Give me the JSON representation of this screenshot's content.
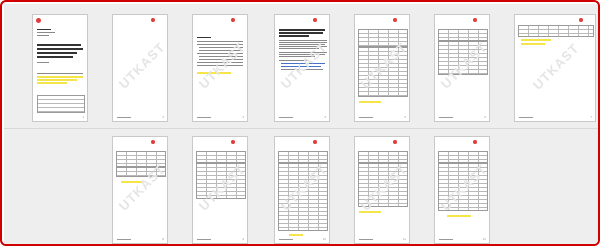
{
  "viewer": {
    "watermark": "UTKAST"
  },
  "pages": [
    {
      "number": "1"
    },
    {
      "number": "2"
    },
    {
      "number": "3"
    },
    {
      "number": "4"
    },
    {
      "number": "5"
    },
    {
      "number": "6"
    },
    {
      "number": "7"
    },
    {
      "number": "8"
    },
    {
      "number": "9"
    },
    {
      "number": "10"
    },
    {
      "number": "11"
    },
    {
      "number": "12"
    },
    {
      "number": "13"
    }
  ],
  "colors": {
    "frame_border": "#d00000",
    "highlight": "#f4e64a",
    "logo": "#d81c1c"
  }
}
